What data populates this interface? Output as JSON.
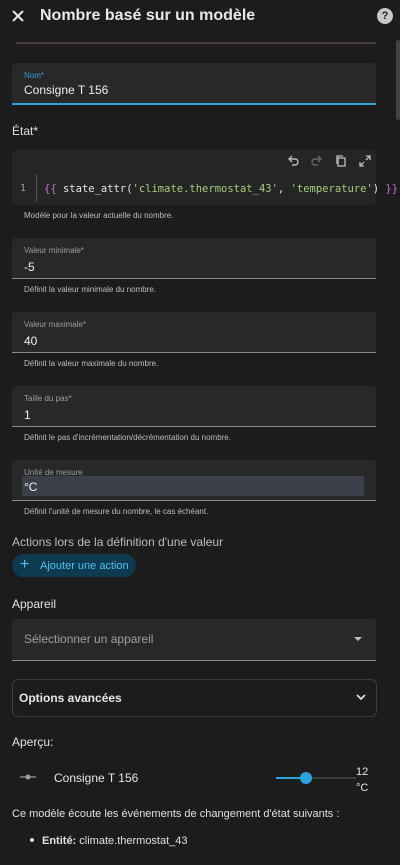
{
  "header": {
    "title": "Nombre basé sur un modèle",
    "help": "?"
  },
  "name_field": {
    "label": "Nom*",
    "value": "Consigne T 156"
  },
  "state": {
    "section_label": "État*",
    "line_number": "1",
    "code_open": "{{",
    "code_fn": " state_attr(",
    "code_arg1": "'climate.thermostat_43'",
    "code_sep": ", ",
    "code_arg2": "'temperature'",
    "code_close_paren": ") ",
    "code_close": "}}",
    "helper": "Modèle pour la valeur actuelle du nombre."
  },
  "min_field": {
    "label": "Valeur minimale*",
    "value": "-5",
    "helper": "Définit la valeur minimale du nombre."
  },
  "max_field": {
    "label": "Valeur maximale*",
    "value": "40",
    "helper": "Définit la valeur maximale du nombre."
  },
  "step_field": {
    "label": "Taille du pas*",
    "value": "1",
    "helper": "Définit le pas d'incrémentation/décrémentation du nombre."
  },
  "unit_field": {
    "label": "Unité de mesure",
    "value": "°C",
    "helper": "Définit l'unité de mesure du nombre, le cas échéant."
  },
  "actions": {
    "section_label": "Actions lors de la définition d'une valeur",
    "add_label": "Ajouter une action"
  },
  "device": {
    "section_label": "Appareil",
    "placeholder": "Sélectionner un appareil"
  },
  "advanced": {
    "label": "Options avancées"
  },
  "preview": {
    "section_label": "Aperçu:",
    "entity_name": "Consigne T 156",
    "value": "12",
    "unit": "°C",
    "slider_fraction": 0.38,
    "listens_text": "Ce modèle écoute les événements de changement d'état suivants :",
    "entity_prefix": "Entité:",
    "entity_id": "climate.thermostat_43"
  },
  "colors": {
    "accent": "#2aa3e0",
    "accent_text": "#4fc3f7",
    "background": "#1c1c1c",
    "field": "#282828"
  }
}
